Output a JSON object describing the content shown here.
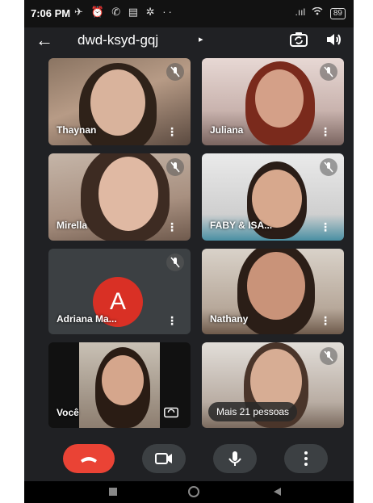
{
  "status_bar": {
    "time": "7:06 PM",
    "notification_icons": "✈ ⏰ ✆ ▤ ✲ ··",
    "signal": ".ııl",
    "wifi": "wifi",
    "battery": "89"
  },
  "header": {
    "meeting_code": "dwd-ksyd-gqj",
    "caret": "▸"
  },
  "participants": [
    {
      "name": "Thaynan"
    },
    {
      "name": "Juliana"
    },
    {
      "name": "Mirella"
    },
    {
      "name": "FABY & ISA..."
    },
    {
      "name": "Adriana Ma...",
      "avatar_letter": "A"
    },
    {
      "name": "Nathany"
    },
    {
      "name": "Você"
    },
    {
      "more_label": "Mais 21 pessoas"
    }
  ],
  "colors": {
    "background": "#202124",
    "end_call": "#ea4335",
    "avatar": "#d93025",
    "control_button": "#3c4043"
  },
  "icons": {
    "back": "arrow-left-icon",
    "switch_camera": "switch-camera-icon",
    "speaker": "speaker-icon",
    "mute": "mic-off-icon",
    "end_call": "hang-up-icon",
    "camera": "video-camera-icon",
    "mic": "microphone-icon",
    "more": "more-vertical-icon"
  }
}
